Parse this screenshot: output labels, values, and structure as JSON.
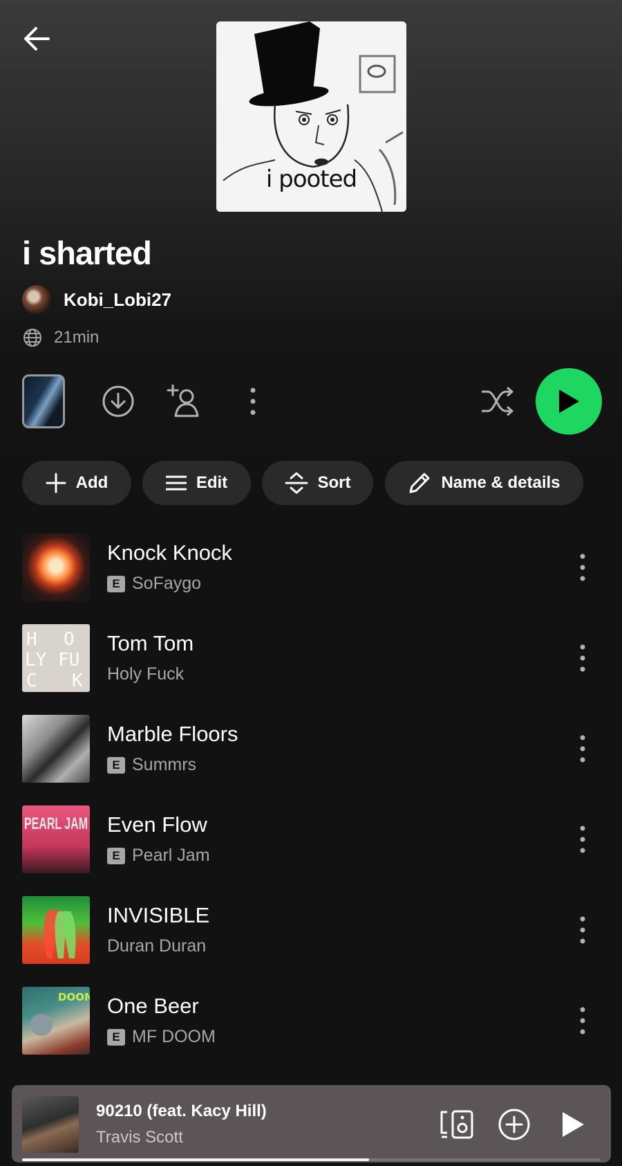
{
  "playlist": {
    "title": "i sharted",
    "cover_caption": "i pooted",
    "owner": "Kobi_Lobi27",
    "duration": "21min"
  },
  "chips": {
    "add": "Add",
    "edit": "Edit",
    "sort": "Sort",
    "details": "Name & details"
  },
  "tracks": [
    {
      "title": "Knock Knock",
      "artist": "SoFaygo",
      "explicit": true
    },
    {
      "title": "Tom Tom",
      "artist": "Holy Fuck",
      "explicit": false
    },
    {
      "title": "Marble Floors",
      "artist": "Summrs",
      "explicit": true
    },
    {
      "title": "Even Flow",
      "artist": "Pearl Jam",
      "explicit": true
    },
    {
      "title": "INVISIBLE",
      "artist": "Duran Duran",
      "explicit": false
    },
    {
      "title": "One Beer",
      "artist": "MF DOOM",
      "explicit": true
    }
  ],
  "explicit_label": "E",
  "art_text": {
    "holy_fuck": [
      "H",
      "O",
      "LY",
      "FU",
      "C",
      "K"
    ],
    "pearl_jam": "PEARL JAM",
    "doom": "DOOM"
  },
  "now_playing": {
    "title": "90210 (feat. Kacy Hill)",
    "artist": "Travis Scott",
    "progress": 0.6
  },
  "colors": {
    "accent_green": "#1ed760",
    "mini_player_bg": "#5c5558",
    "secondary_text": "#a7a7a7"
  },
  "icons": [
    "back-arrow-icon",
    "download-icon",
    "add-user-icon",
    "more-vertical-icon",
    "shuffle-icon",
    "play-icon",
    "globe-icon",
    "plus-icon",
    "menu-lines-icon",
    "sort-icon",
    "pencil-icon",
    "devices-icon",
    "add-circle-icon"
  ]
}
